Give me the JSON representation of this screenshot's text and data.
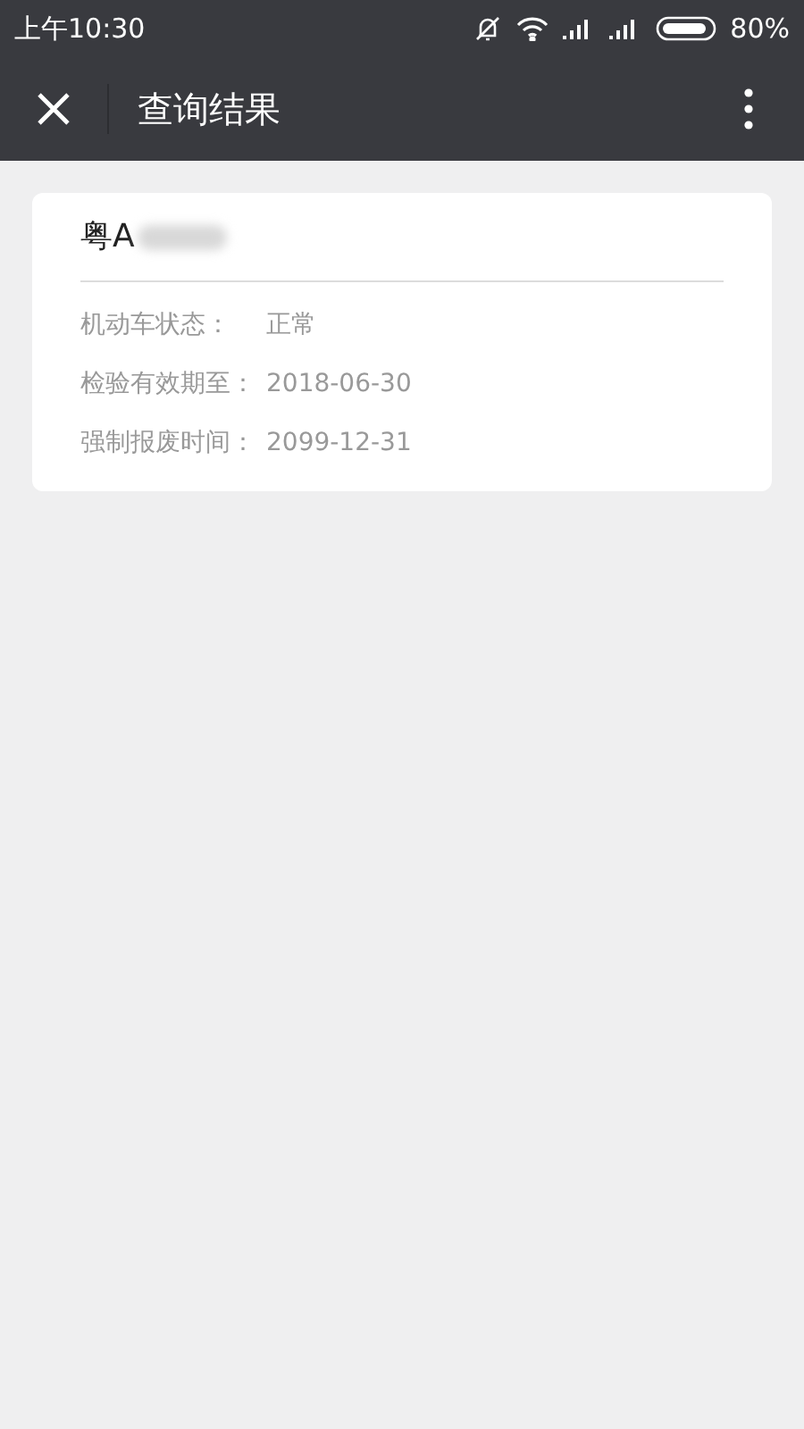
{
  "status_bar": {
    "time": "上午10:30",
    "battery": "80%"
  },
  "nav_bar": {
    "title": "查询结果"
  },
  "card": {
    "plate": "粤A",
    "rows": [
      {
        "label": "机动车状态：",
        "value": "正常"
      },
      {
        "label": "检验有效期至：",
        "value": "2018-06-30"
      },
      {
        "label": "强制报废时间：",
        "value": "2099-12-31"
      }
    ]
  }
}
